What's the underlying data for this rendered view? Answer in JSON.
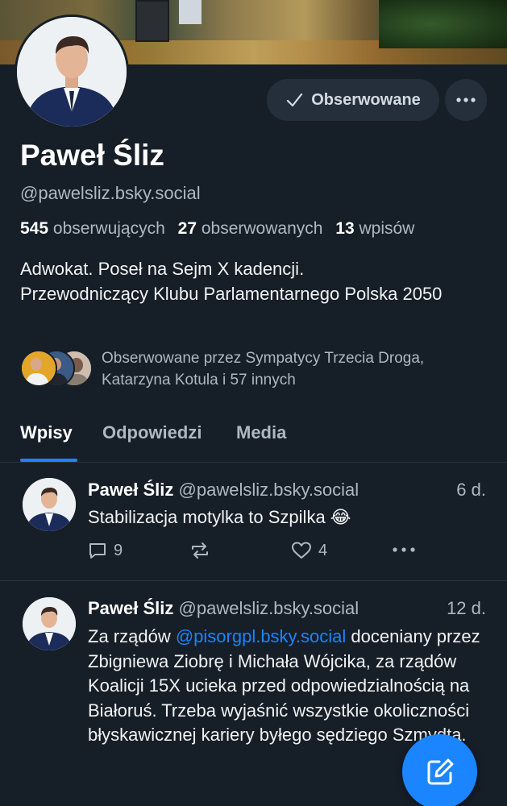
{
  "profile": {
    "name": "Paweł Śliz",
    "handle": "@pawelsliz.bsky.social",
    "follow_button": "Obserwowane",
    "followers_count": "545",
    "followers_label": "obserwujących",
    "following_count": "27",
    "following_label": "obserwowanych",
    "posts_count": "13",
    "posts_label": "wpisów",
    "bio_line1": "Adwokat. Poseł na Sejm X kadencji.",
    "bio_line2": "Przewodniczący Klubu Parlamentarnego Polska 2050",
    "followed_by": "Obserwowane przez Sympatycy Trzecia Droga, Katarzyna Kotula i 57 innych"
  },
  "tabs": [
    {
      "label": "Wpisy",
      "active": true
    },
    {
      "label": "Odpowiedzi",
      "active": false
    },
    {
      "label": "Media",
      "active": false
    }
  ],
  "posts": [
    {
      "author": "Paweł Śliz",
      "handle": "@pawelsliz.bsky.social",
      "time": "6 d.",
      "text": "Stabilizacja motylka to Szpilka 😂",
      "replies": "9",
      "reposts": "",
      "likes": "4"
    },
    {
      "author": "Paweł Śliz",
      "handle": "@pawelsliz.bsky.social",
      "time": "12 d.",
      "text_before": "Za rządów ",
      "mention": "@pisorgpl.bsky.social",
      "text_after": " doceniany przez Zbigniewa Ziobrę i Michała Wójcika, za rządów Koalicji 15X ucieka przed odpowiedzialnością na Białoruś. Trzeba wyjaśnić wszystkie okoliczności błyskawicznej kariery byłego sędziego Szmydta."
    }
  ],
  "icons": {
    "check": "check-icon",
    "more": "more-dots-icon",
    "reply": "reply-icon",
    "repost": "repost-icon",
    "like": "heart-icon",
    "compose": "compose-icon"
  },
  "colors": {
    "background": "#161e27",
    "accent": "#1a85ff",
    "muted": "#aeb8c3",
    "button_bg": "#242f3b"
  }
}
